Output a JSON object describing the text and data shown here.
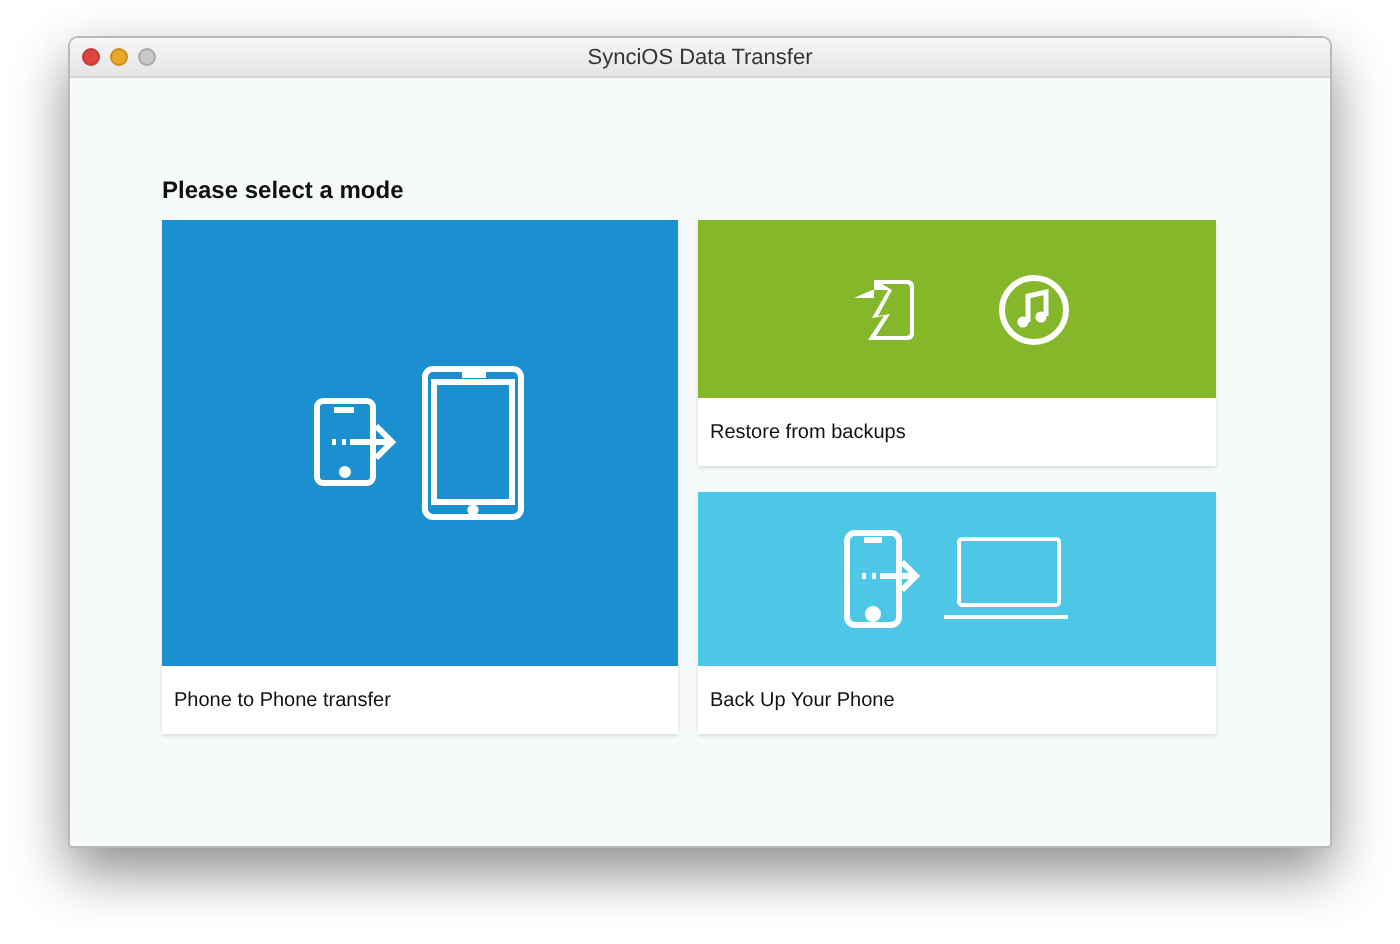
{
  "window": {
    "title": "SynciOS Data Transfer"
  },
  "heading": "Please select a mode",
  "modes": [
    {
      "kind": "phone-to-phone",
      "label": "Phone to Phone transfer",
      "color": "#1a90d0"
    },
    {
      "kind": "restore",
      "label": "Restore from backups",
      "color": "#85b72b"
    },
    {
      "kind": "backup",
      "label": "Back Up Your Phone",
      "color": "#4cc8e6"
    }
  ]
}
